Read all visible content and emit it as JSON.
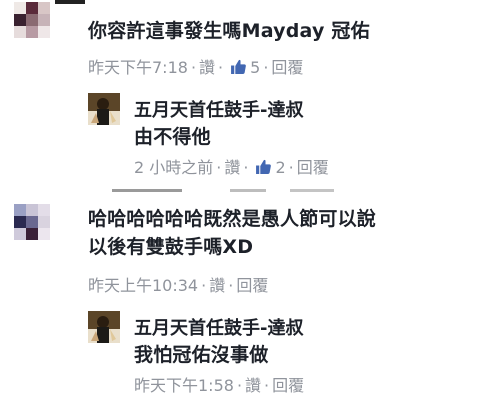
{
  "comments": [
    {
      "text_lines": [
        "你容許這事發生嗎Mayday 冠佑"
      ],
      "meta": {
        "time": "昨天下午7:18",
        "reply": "讚",
        "like_count": "5",
        "reply_link": "回覆"
      },
      "replies": [
        {
          "author": "五月天首任鼓手-達叔",
          "text": "由不得他",
          "meta": {
            "time": "2 小時之前",
            "reply": "讚",
            "like_count": "2",
            "reply_link": "回覆"
          }
        }
      ]
    },
    {
      "text_lines": [
        "哈哈哈哈哈哈既然是愚人節可以說",
        "以後有雙鼓手嗎XD"
      ],
      "meta": {
        "time": "昨天上午10:34",
        "reply": "讚",
        "reply_link": "回覆"
      },
      "replies": [
        {
          "author": "五月天首任鼓手-達叔",
          "text": "我怕冠佑沒事做",
          "meta": {
            "time": "昨天下午1:58",
            "reply": "讚",
            "reply_link": "回覆"
          }
        }
      ]
    }
  ],
  "separator": "·",
  "icons": {
    "like": "thumbs-up-icon"
  },
  "colors": {
    "text": "#1d2129",
    "meta": "#90949c",
    "like_blue": "#4267b2"
  }
}
